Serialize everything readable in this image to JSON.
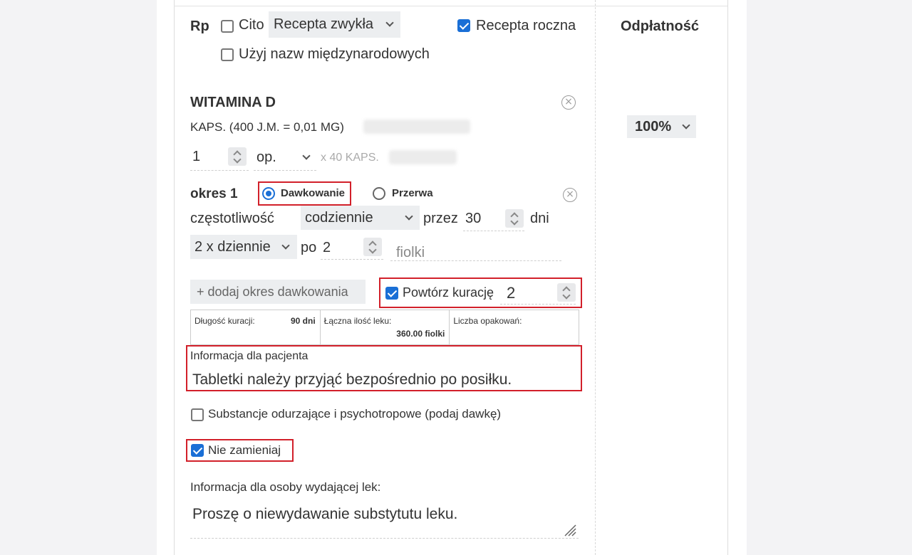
{
  "header": {
    "rp_label": "Rp",
    "cito_label": "Cito",
    "recipe_type": "Recepta zwykła",
    "annual_label": "Recepta roczna",
    "intl_names_label": "Użyj nazw międzynarodowych",
    "payment_label": "Odpłatność"
  },
  "drug": {
    "name": "WITAMINA D",
    "form": "KAPS. (400 J.M. = 0,01 MG)",
    "qty": "1",
    "unit": "op.",
    "pack": "x 40 KAPS.",
    "payment_value": "100%"
  },
  "period": {
    "label": "okres 1",
    "dosing_label": "Dawkowanie",
    "break_label": "Przerwa",
    "frequency_label": "częstotliwość",
    "frequency_value": "codziennie",
    "for_label": "przez",
    "days_value": "30",
    "days_label": "dni",
    "times_value": "2 x dziennie",
    "per_label": "po",
    "dose_value": "2",
    "dose_unit_placeholder": "fiolki"
  },
  "add_period_label": "+ dodaj okres dawkowania",
  "repeat": {
    "label": "Powtórz kurację",
    "value": "2"
  },
  "summary": {
    "duration_label": "Długość kuracji:",
    "duration_value": "90 dni",
    "total_label": "Łączna ilość leku:",
    "total_value": "360.00 fiolki",
    "packs_label": "Liczba opakowań:"
  },
  "patient_info": {
    "label": "Informacja dla pacjenta",
    "value": "Tabletki należy przyjąć bezpośrednio po posiłku."
  },
  "narcotics_label": "Substancje odurzające i psychotropowe (podaj dawkę)",
  "no_substitute_label": "Nie zamieniaj",
  "pharmacist_info": {
    "label": "Informacja dla osoby wydającej lek:",
    "value": "Proszę o niewydawanie substytutu leku."
  },
  "colors": {
    "accent": "#1a6fd6",
    "highlight": "#d2202a"
  }
}
